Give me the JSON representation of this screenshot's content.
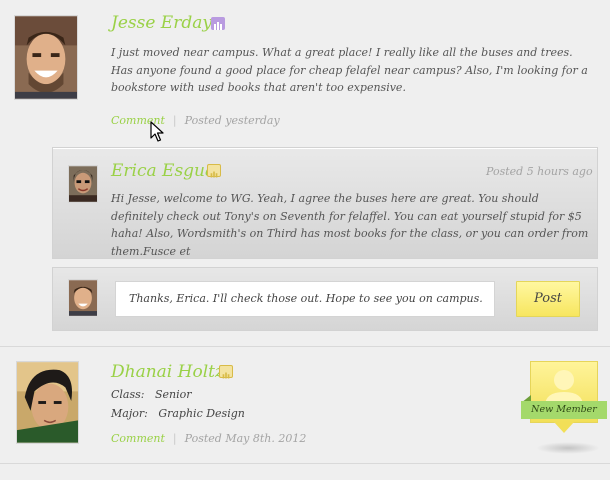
{
  "post1": {
    "name": "Jesse Erday",
    "text": "I just moved near campus. What a great place! I really like all the buses and trees.  Has anyone found a good place for cheap felafel near campus?  Also, I'm looking for a bookstore with used books that aren't too expensive.",
    "comment_label": "Comment",
    "separator": "|",
    "posted": "Posted yesterday"
  },
  "reply": {
    "name": "Erica Esgua",
    "posted": "Posted 5 hours ago",
    "text": "Hi Jesse, welcome to WG.  Yeah, I agree the buses here are great.  You should definitely check out Tony's on Seventh for felaffel. You can eat yourself stupid for $5 haha!  Also, Wordsmith's on Third has most books for the class, or you can order from them.Fusce et"
  },
  "compose": {
    "value": "Thanks, Erica.  I'll check those out.  Hope to see you on campus.",
    "post_label": "Post"
  },
  "post2": {
    "name": "Dhanai Holtz",
    "class_label": "Class:",
    "class_value": "Senior",
    "major_label": "Major:",
    "major_value": "Graphic Design",
    "comment_label": "Comment",
    "separator": "|",
    "posted": "Posted May 8th. 2012",
    "new_member_label": "New Member"
  },
  "colors": {
    "accent_green": "#9ad147",
    "badge_purple": "#b99be0",
    "badge_gold": "#d8bb48",
    "post_yellow": "#f7e65f"
  },
  "icons": [
    "member-badge-icon",
    "mouse-cursor-icon",
    "person-silhouette-icon"
  ]
}
